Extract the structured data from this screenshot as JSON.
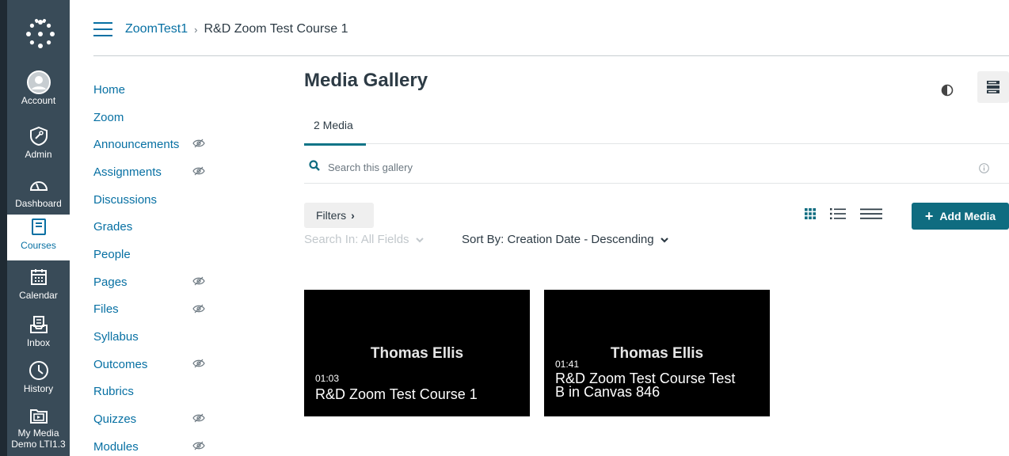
{
  "global_nav": {
    "items": [
      {
        "label": "Account",
        "icon": "account-icon"
      },
      {
        "label": "Admin",
        "icon": "admin-icon"
      },
      {
        "label": "Dashboard",
        "icon": "dashboard-icon"
      },
      {
        "label": "Courses",
        "icon": "courses-icon",
        "active": true
      },
      {
        "label": "Calendar",
        "icon": "calendar-icon"
      },
      {
        "label": "Inbox",
        "icon": "inbox-icon"
      },
      {
        "label": "History",
        "icon": "history-icon"
      },
      {
        "label": "My Media Demo LTI1.3",
        "icon": "my-media-icon"
      }
    ]
  },
  "header": {
    "breadcrumb_course": "ZoomTest1",
    "breadcrumb_separator": "›",
    "breadcrumb_current": "R&D Zoom Test Course 1"
  },
  "course_nav": {
    "items": [
      {
        "label": "Home"
      },
      {
        "label": "Zoom"
      },
      {
        "label": "Announcements",
        "hidden": true
      },
      {
        "label": "Assignments",
        "hidden": true
      },
      {
        "label": "Discussions"
      },
      {
        "label": "Grades"
      },
      {
        "label": "People"
      },
      {
        "label": "Pages",
        "hidden": true
      },
      {
        "label": "Files",
        "hidden": true
      },
      {
        "label": "Syllabus"
      },
      {
        "label": "Outcomes",
        "hidden": true
      },
      {
        "label": "Rubrics"
      },
      {
        "label": "Quizzes",
        "hidden": true
      },
      {
        "label": "Modules",
        "hidden": true
      }
    ]
  },
  "main": {
    "title": "Media Gallery",
    "tab_label": "2 Media",
    "search_placeholder": "Search this gallery",
    "filters_label": "Filters",
    "filters_chevron": "›",
    "search_in": "Search In: All Fields",
    "sort_by": "Sort By: Creation Date - Descending",
    "add_media_label": "Add Media",
    "add_media_plus": "+",
    "accent_color": "#0f6c80",
    "link_color": "#0770a3"
  },
  "media": [
    {
      "owner": "Thomas Ellis",
      "duration": "01:03",
      "title": "R&D Zoom Test Course 1"
    },
    {
      "owner": "Thomas Ellis",
      "duration": "01:41",
      "title": "R&D Zoom Test Course Test B in Canvas 846"
    }
  ]
}
